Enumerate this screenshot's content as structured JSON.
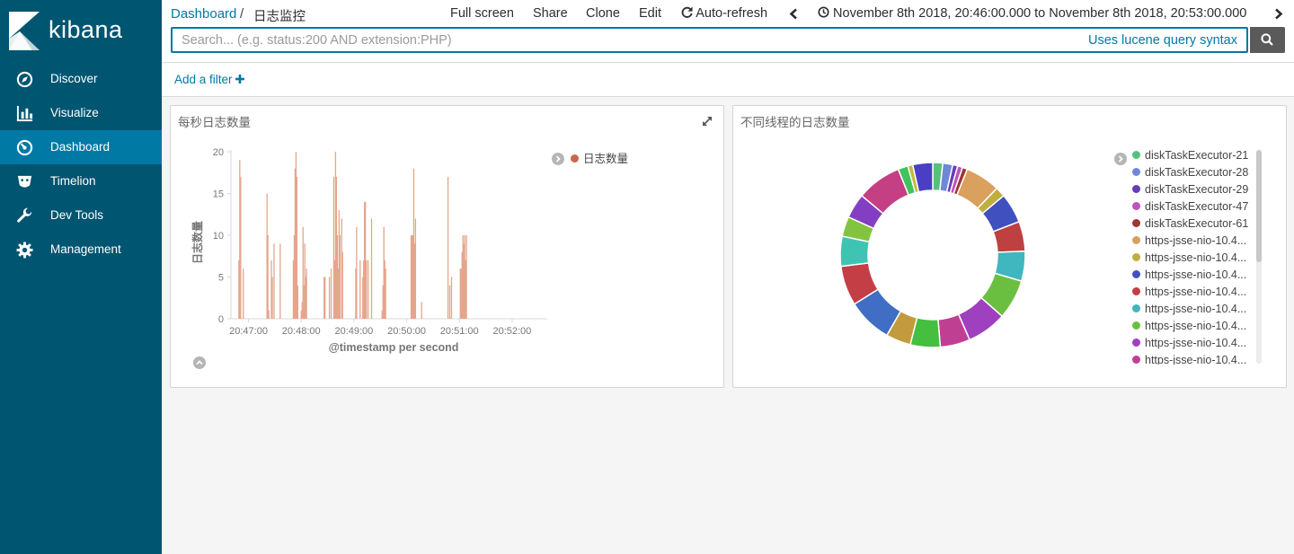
{
  "app": {
    "name": "kibana"
  },
  "nav": {
    "items": [
      {
        "label": "Discover",
        "icon": "compass-icon"
      },
      {
        "label": "Visualize",
        "icon": "bar-chart-icon"
      },
      {
        "label": "Dashboard",
        "icon": "dashboard-icon",
        "active": true
      },
      {
        "label": "Timelion",
        "icon": "timelion-icon"
      },
      {
        "label": "Dev Tools",
        "icon": "wrench-icon"
      },
      {
        "label": "Management",
        "icon": "gear-icon"
      }
    ]
  },
  "breadcrumb": {
    "root": "Dashboard",
    "sep": "/",
    "current": "日志监控"
  },
  "toolbar": {
    "full_screen": "Full screen",
    "share": "Share",
    "clone": "Clone",
    "edit": "Edit",
    "auto_refresh": "Auto-refresh",
    "time_range": "November 8th 2018, 20:46:00.000 to November 8th 2018, 20:53:00.000"
  },
  "search": {
    "placeholder": "Search... (e.g. status:200 AND extension:PHP)",
    "value": "",
    "syntax_link": "Uses lucene query syntax"
  },
  "filters": {
    "add_label": "Add a filter"
  },
  "panels": {
    "bar": {
      "title": "每秒日志数量"
    },
    "donut": {
      "title": "不同线程的日志数量"
    }
  },
  "colors": {
    "accent": "#0079a5",
    "sidebar": "#005571",
    "bar": "#e5a58c"
  },
  "chart_data": [
    {
      "type": "bar",
      "title": "",
      "xlabel": "@timestamp per second",
      "ylabel": "日志数量",
      "ylim": [
        0,
        20
      ],
      "yticks": [
        0,
        5,
        10,
        15,
        20
      ],
      "xticks": [
        "20:47:00",
        "20:48:00",
        "20:49:00",
        "20:50:00",
        "20:51:00",
        "20:52:00"
      ],
      "x_range": [
        "20:46:40",
        "20:52:40"
      ],
      "series": [
        {
          "name": "日志数量",
          "color": "#e5a58c",
          "x": [
            "20:46:49",
            "20:46:50",
            "20:46:51",
            "20:46:54",
            "20:47:21",
            "20:47:22",
            "20:47:23",
            "20:47:26",
            "20:47:27",
            "20:47:29",
            "20:47:36",
            "20:47:51",
            "20:47:52",
            "20:47:53",
            "20:47:54",
            "20:47:55",
            "20:47:56",
            "20:48:00",
            "20:48:01",
            "20:48:02",
            "20:48:03",
            "20:48:04",
            "20:48:05",
            "20:48:06",
            "20:48:26",
            "20:48:27",
            "20:48:32",
            "20:48:34",
            "20:48:37",
            "20:48:38",
            "20:48:39",
            "20:48:40",
            "20:48:41",
            "20:48:42",
            "20:48:43",
            "20:48:44",
            "20:48:46",
            "20:48:47",
            "20:49:02",
            "20:49:03",
            "20:49:07",
            "20:49:10",
            "20:49:11",
            "20:49:12",
            "20:49:13",
            "20:49:14",
            "20:49:16",
            "20:49:20",
            "20:49:32",
            "20:49:33",
            "20:49:34",
            "20:49:35",
            "20:49:36",
            "20:50:05",
            "20:50:06",
            "20:50:07",
            "20:50:08",
            "20:50:09",
            "20:50:10",
            "20:50:17",
            "20:50:47",
            "20:50:49",
            "20:50:51",
            "20:51:01",
            "20:51:02",
            "20:51:03",
            "20:51:04",
            "20:51:05",
            "20:51:06",
            "20:51:07",
            "20:51:08"
          ],
          "values": [
            7,
            19,
            17,
            6,
            15,
            10,
            1,
            7,
            5,
            9,
            9,
            7,
            10,
            18,
            20,
            17,
            4,
            1,
            2,
            11,
            4,
            9,
            5,
            6,
            5,
            5,
            5,
            6,
            17,
            7,
            20,
            17,
            10,
            6,
            13,
            10,
            12,
            8,
            6,
            11,
            7,
            5,
            7,
            14,
            14,
            7,
            7,
            12,
            1,
            4,
            11,
            7,
            6,
            10,
            10,
            10,
            18,
            9,
            12,
            2,
            17,
            4,
            5,
            6,
            6,
            8,
            10,
            9,
            10,
            7,
            10
          ]
        }
      ]
    },
    {
      "type": "pie",
      "title": "",
      "donut": true,
      "legend_position": "right",
      "slices": [
        {
          "label": "diskTaskExecutor-21",
          "value": 2,
          "color": "#57c17b"
        },
        {
          "label": "diskTaskExecutor-28",
          "value": 2,
          "color": "#6f87d8"
        },
        {
          "label": "diskTaskExecutor-29",
          "value": 1,
          "color": "#663db8"
        },
        {
          "label": "diskTaskExecutor-47",
          "value": 1,
          "color": "#bc52bc"
        },
        {
          "label": "diskTaskExecutor-61",
          "value": 1,
          "color": "#9e3533"
        },
        {
          "label": "https-jsse-nio-10.4...",
          "value": 7,
          "color": "#daa05d"
        },
        {
          "label": "https-jsse-nio-10.4...",
          "value": 2,
          "color": "#bfaf40"
        },
        {
          "label": "https-jsse-nio-10.4...",
          "value": 6,
          "color": "#4050bf"
        },
        {
          "label": "https-jsse-nio-10.4...",
          "value": 6,
          "color": "#bf4040"
        },
        {
          "label": "https-jsse-nio-10.4...",
          "value": 6,
          "color": "#40b6bf"
        },
        {
          "label": "https-jsse-nio-10.4...",
          "value": 8,
          "color": "#6bbf40"
        },
        {
          "label": "https-jsse-nio-10.4...",
          "value": 8,
          "color": "#9f40bf"
        },
        {
          "label": "https-jsse-nio-10.4...",
          "value": 6,
          "color": "#bf4093"
        },
        {
          "label": "https-jsse-nio-10.4...",
          "value": 6,
          "color": "#44bf40"
        },
        {
          "label": "https-jsse-nio-10.4...",
          "value": 5,
          "color": "#c49a3e"
        },
        {
          "label": "https-jsse-nio-10.4...",
          "value": 9,
          "color": "#3f6ec4"
        },
        {
          "label": "https-jsse-nio-10.4...",
          "value": 8,
          "color": "#c43f45"
        },
        {
          "label": "https-jsse-nio-10.4...",
          "value": 6,
          "color": "#3fc4b4"
        },
        {
          "label": "https-jsse-nio-10.4...",
          "value": 4,
          "color": "#82c43f"
        },
        {
          "label": "https-jsse-nio-10.4...",
          "value": 5,
          "color": "#823fc4"
        },
        {
          "label": "https-jsse-nio-10.4...",
          "value": 9,
          "color": "#c43f84"
        },
        {
          "label": "https-jsse-nio-10.4...",
          "value": 2,
          "color": "#3fc45c"
        },
        {
          "label": "https-jsse-nio-10.4...",
          "value": 1,
          "color": "#c4b83f"
        },
        {
          "label": "https-jsse-nio-10.4...",
          "value": 4,
          "color": "#4a3fc4"
        }
      ]
    }
  ]
}
